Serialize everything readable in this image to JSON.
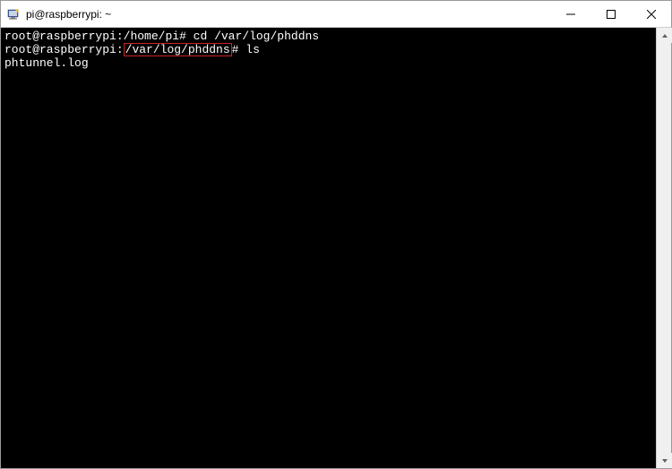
{
  "window": {
    "title": "pi@raspberrypi: ~"
  },
  "terminal": {
    "lines": [
      {
        "prompt_user": "root@raspberrypi",
        "prompt_sep": ":",
        "prompt_path": "/home/pi",
        "prompt_end": "# ",
        "command": "cd /var/log/phddns",
        "highlighted": false
      },
      {
        "prompt_user": "root@raspberrypi",
        "prompt_sep": ":",
        "prompt_path": "/var/log/phddns",
        "prompt_end": "# ",
        "command": "ls",
        "highlighted": true
      }
    ],
    "output": "phtunnel.log"
  }
}
